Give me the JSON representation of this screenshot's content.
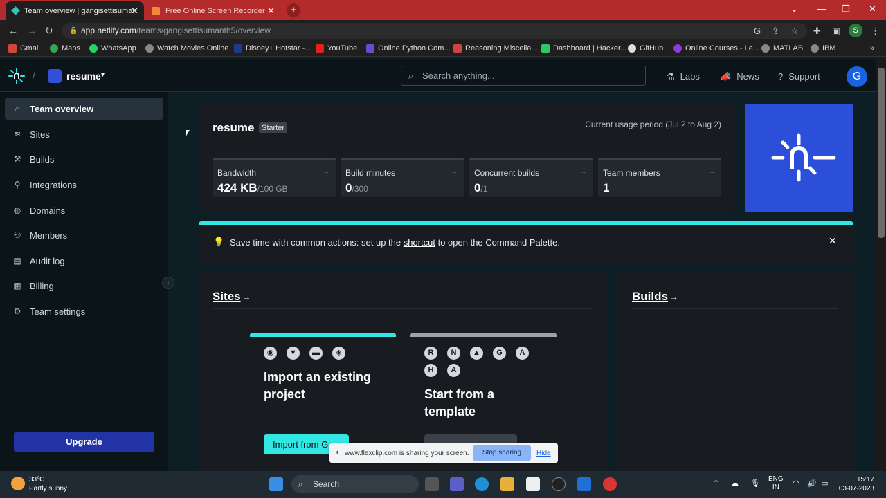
{
  "browser": {
    "tabs": [
      {
        "title": "Team overview | gangisettisuman",
        "active": true
      },
      {
        "title": "Free Online Screen Recorder",
        "active": false
      }
    ],
    "new_tab": "+",
    "url_host": "app.netlify.com",
    "url_path": "/teams/gangisettisumanth5/overview",
    "profile_initial": "S",
    "bookmarks": [
      "Gmail",
      "Maps",
      "WhatsApp",
      "Watch Movies Online",
      "Disney+ Hotstar -...",
      "YouTube",
      "Online Python Com...",
      "Reasoning Miscella...",
      "Dashboard | Hacker...",
      "GitHub",
      "Online Courses - Le...",
      "MATLAB",
      "IBM"
    ]
  },
  "header": {
    "team_name": "resume",
    "search_placeholder": "Search anything...",
    "links": [
      "Labs",
      "News",
      "Support"
    ],
    "avatar_initial": "G"
  },
  "sidebar": {
    "items": [
      "Team overview",
      "Sites",
      "Builds",
      "Integrations",
      "Domains",
      "Members",
      "Audit log",
      "Billing",
      "Team settings"
    ],
    "active": "Team overview",
    "upgrade_label": "Upgrade"
  },
  "team_card": {
    "title": "resume",
    "plan_badge": "Starter",
    "usage_period": "Current usage period (Jul 2 to Aug 2)",
    "stats": [
      {
        "label": "Bandwidth",
        "value": "424 KB",
        "limit": "/100 GB"
      },
      {
        "label": "Build minutes",
        "value": "0",
        "limit": "/300"
      },
      {
        "label": "Concurrent builds",
        "value": "0",
        "limit": "/1"
      },
      {
        "label": "Team members",
        "value": "1",
        "limit": ""
      }
    ]
  },
  "tip": {
    "before": "Save time with common actions: set up the ",
    "link": "shortcut",
    "after": " to open the Command Palette."
  },
  "sites": {
    "title": "Sites",
    "import_title": "Import an existing project",
    "import_button": "Import from G",
    "template_title": "Start from a template"
  },
  "builds": {
    "title": "Builds"
  },
  "screen_share": {
    "message": "www.flexclip.com is sharing your screen.",
    "stop": "Stop sharing",
    "hide": "Hide"
  },
  "taskbar": {
    "temperature": "33°C",
    "condition": "Partly sunny",
    "search": "Search",
    "lang": "ENG",
    "region": "IN",
    "time": "15:17",
    "date": "03-07-2023"
  },
  "colors": {
    "accent": "#32e6e2",
    "brand_blue": "#2c4fd9",
    "tab_bar": "#b52a2a"
  }
}
